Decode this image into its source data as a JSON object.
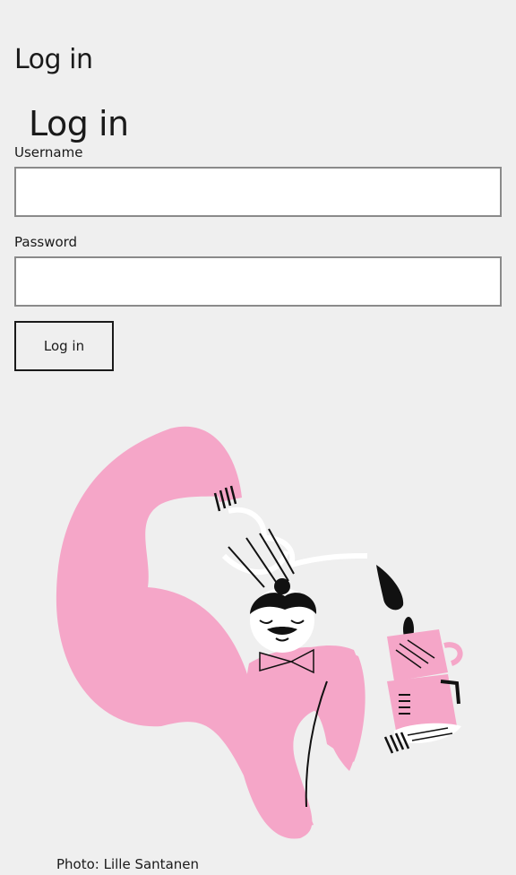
{
  "page": {
    "title": "Log in"
  },
  "form": {
    "heading": "Log in",
    "username_label": "Username",
    "username_value": "",
    "password_label": "Password",
    "password_value": "",
    "submit_label": "Log in"
  },
  "illustration": {
    "description_icon": "chef-pouring-coffee-illustration",
    "accent_color": "#f5a6c8"
  },
  "credit": {
    "text": "Photo: Lille Santanen"
  }
}
